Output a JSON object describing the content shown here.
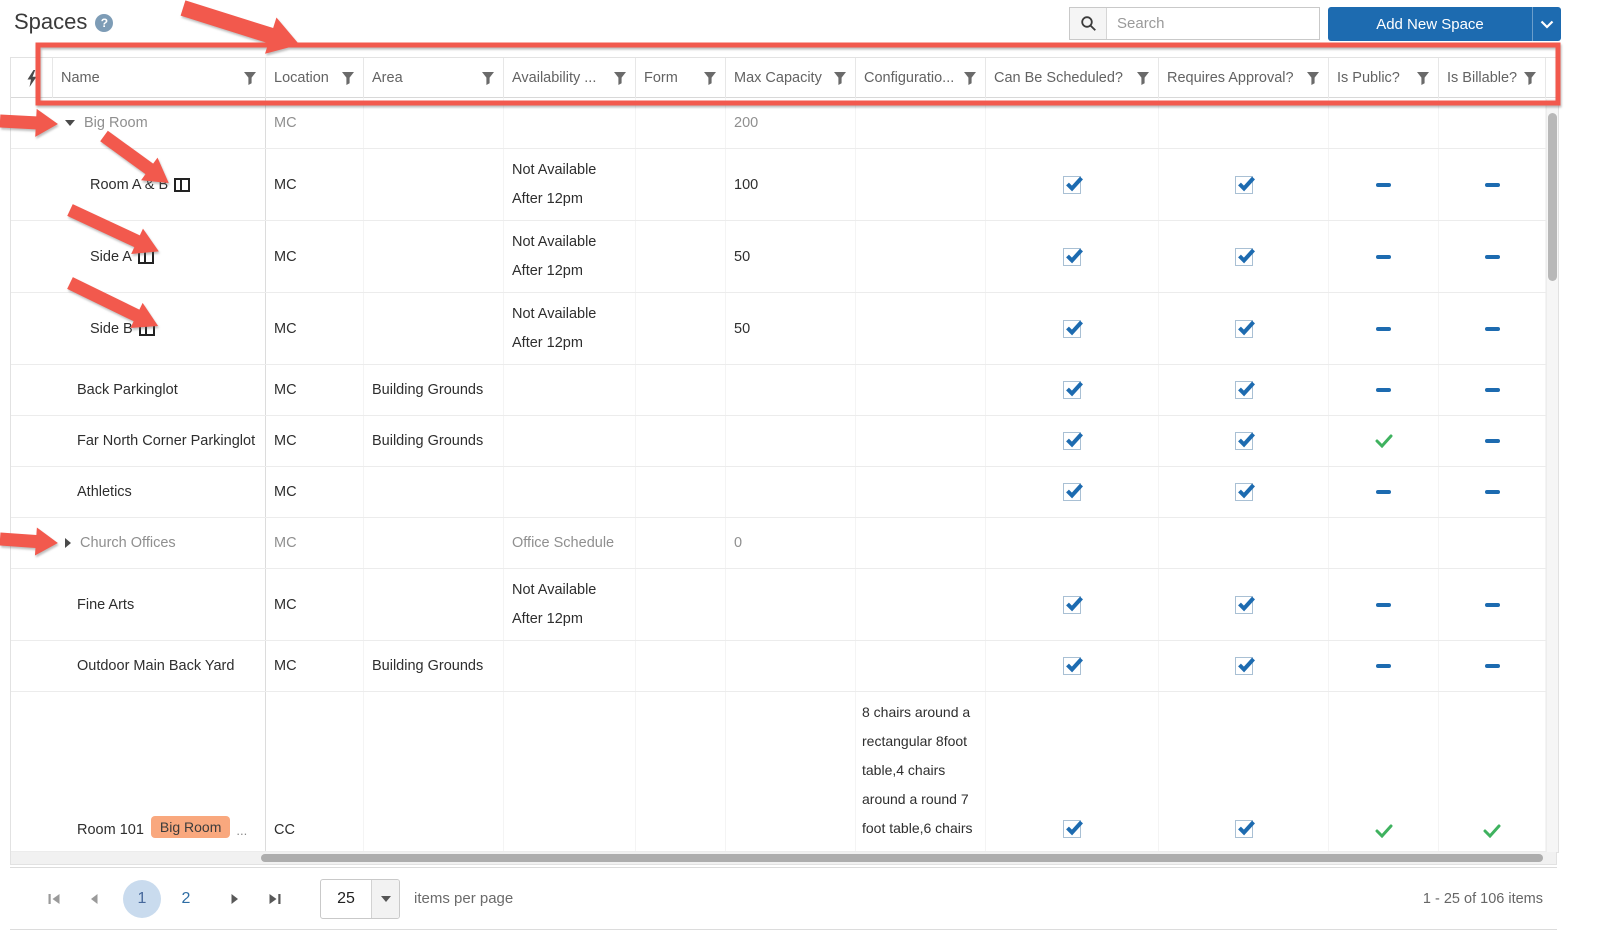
{
  "page": {
    "title": "Spaces",
    "help_glyph": "?"
  },
  "toolbar": {
    "search_placeholder": "Search",
    "add_new_space_label": "Add New Space"
  },
  "colors": {
    "accent_blue": "#1d6bb0",
    "success_green": "#3fb25f",
    "badge_orange": "#f9a87e",
    "annotation_red": "#f2594d"
  },
  "table": {
    "columns": [
      {
        "label": "",
        "icon": "lightning"
      },
      {
        "label": "Name",
        "filter": true
      },
      {
        "label": "Location",
        "filter": true
      },
      {
        "label": "Area",
        "filter": true
      },
      {
        "label": "Availability ...",
        "filter": true
      },
      {
        "label": "Form",
        "filter": true
      },
      {
        "label": "Max Capacity",
        "filter": true
      },
      {
        "label": "Configuratio...",
        "filter": true
      },
      {
        "label": "Can Be Scheduled?",
        "filter": true
      },
      {
        "label": "Requires Approval?",
        "filter": true
      },
      {
        "label": "Is Public?",
        "filter": true
      },
      {
        "label": "Is Billable?",
        "filter": true
      }
    ],
    "rows": [
      {
        "name": "Big Room",
        "expand": "expanded",
        "muted": true,
        "indent": "parent",
        "split_icon": false,
        "badge": "",
        "badge_suffix": "",
        "location": "MC",
        "area": "",
        "availability": "",
        "form": "",
        "max_capacity": "200",
        "configuration": "",
        "can_be_scheduled": "",
        "requires_approval": "",
        "is_public": "",
        "is_billable": ""
      },
      {
        "name": "Room A & B",
        "expand": "",
        "muted": false,
        "indent": "child",
        "split_icon": true,
        "badge": "",
        "badge_suffix": "",
        "location": "MC",
        "area": "",
        "availability": "Not Available After 12pm",
        "form": "",
        "max_capacity": "100",
        "configuration": "",
        "can_be_scheduled": "checked",
        "requires_approval": "checked",
        "is_public": "dash",
        "is_billable": "dash"
      },
      {
        "name": "Side A",
        "expand": "",
        "muted": false,
        "indent": "child",
        "split_icon": true,
        "badge": "",
        "badge_suffix": "",
        "location": "MC",
        "area": "",
        "availability": "Not Available After 12pm",
        "form": "",
        "max_capacity": "50",
        "configuration": "",
        "can_be_scheduled": "checked",
        "requires_approval": "checked",
        "is_public": "dash",
        "is_billable": "dash"
      },
      {
        "name": "Side B",
        "expand": "",
        "muted": false,
        "indent": "child",
        "split_icon": true,
        "badge": "",
        "badge_suffix": "",
        "location": "MC",
        "area": "",
        "availability": "Not Available After 12pm",
        "form": "",
        "max_capacity": "50",
        "configuration": "",
        "can_be_scheduled": "checked",
        "requires_approval": "checked",
        "is_public": "dash",
        "is_billable": "dash"
      },
      {
        "name": "Back Parkinglot",
        "expand": "",
        "muted": false,
        "indent": "reg",
        "split_icon": false,
        "badge": "",
        "badge_suffix": "",
        "location": "MC",
        "area": "Building Grounds",
        "availability": "",
        "form": "",
        "max_capacity": "",
        "configuration": "",
        "can_be_scheduled": "checked",
        "requires_approval": "checked",
        "is_public": "dash",
        "is_billable": "dash"
      },
      {
        "name": "Far North Corner Parkinglot",
        "expand": "",
        "muted": false,
        "indent": "reg",
        "split_icon": false,
        "badge": "",
        "badge_suffix": "",
        "location": "MC",
        "area": "Building Grounds",
        "availability": "",
        "form": "",
        "max_capacity": "",
        "configuration": "",
        "can_be_scheduled": "checked",
        "requires_approval": "checked",
        "is_public": "check",
        "is_billable": "dash"
      },
      {
        "name": "Athletics",
        "expand": "",
        "muted": false,
        "indent": "reg",
        "split_icon": false,
        "badge": "",
        "badge_suffix": "",
        "location": "MC",
        "area": "",
        "availability": "",
        "form": "",
        "max_capacity": "",
        "configuration": "",
        "can_be_scheduled": "checked",
        "requires_approval": "checked",
        "is_public": "dash",
        "is_billable": "dash"
      },
      {
        "name": "Church Offices",
        "expand": "collapsed",
        "muted": true,
        "indent": "parent",
        "split_icon": false,
        "badge": "",
        "badge_suffix": "",
        "location": "MC",
        "area": "",
        "availability": "Office Schedule",
        "form": "",
        "max_capacity": "0",
        "configuration": "",
        "can_be_scheduled": "",
        "requires_approval": "",
        "is_public": "",
        "is_billable": ""
      },
      {
        "name": "Fine Arts",
        "expand": "",
        "muted": false,
        "indent": "reg",
        "split_icon": false,
        "badge": "",
        "badge_suffix": "",
        "location": "MC",
        "area": "",
        "availability": "Not Available After 12pm",
        "form": "",
        "max_capacity": "",
        "configuration": "",
        "can_be_scheduled": "checked",
        "requires_approval": "checked",
        "is_public": "dash",
        "is_billable": "dash"
      },
      {
        "name": "Outdoor Main Back Yard",
        "expand": "",
        "muted": false,
        "indent": "reg",
        "split_icon": false,
        "badge": "",
        "badge_suffix": "",
        "location": "MC",
        "area": "Building Grounds",
        "availability": "",
        "form": "",
        "max_capacity": "",
        "configuration": "",
        "can_be_scheduled": "checked",
        "requires_approval": "checked",
        "is_public": "dash",
        "is_billable": "dash"
      },
      {
        "name": "Room 101",
        "expand": "",
        "muted": false,
        "indent": "reg",
        "split_icon": false,
        "badge": "Big Room",
        "badge_suffix": "...",
        "location": "CC",
        "area": "",
        "availability": "",
        "form": "",
        "max_capacity": "",
        "configuration": "8 chairs around a rectangular 8foot table,4 chairs around a round 7 foot table,6 chairs",
        "can_be_scheduled": "checked",
        "requires_approval": "checked",
        "is_public": "check",
        "is_billable": "check"
      }
    ]
  },
  "pager": {
    "pages": [
      "1",
      "2"
    ],
    "current_page": "1",
    "page_size": "25",
    "items_per_page_label": "items per page",
    "range_label": "1 - 25 of 106 items"
  }
}
